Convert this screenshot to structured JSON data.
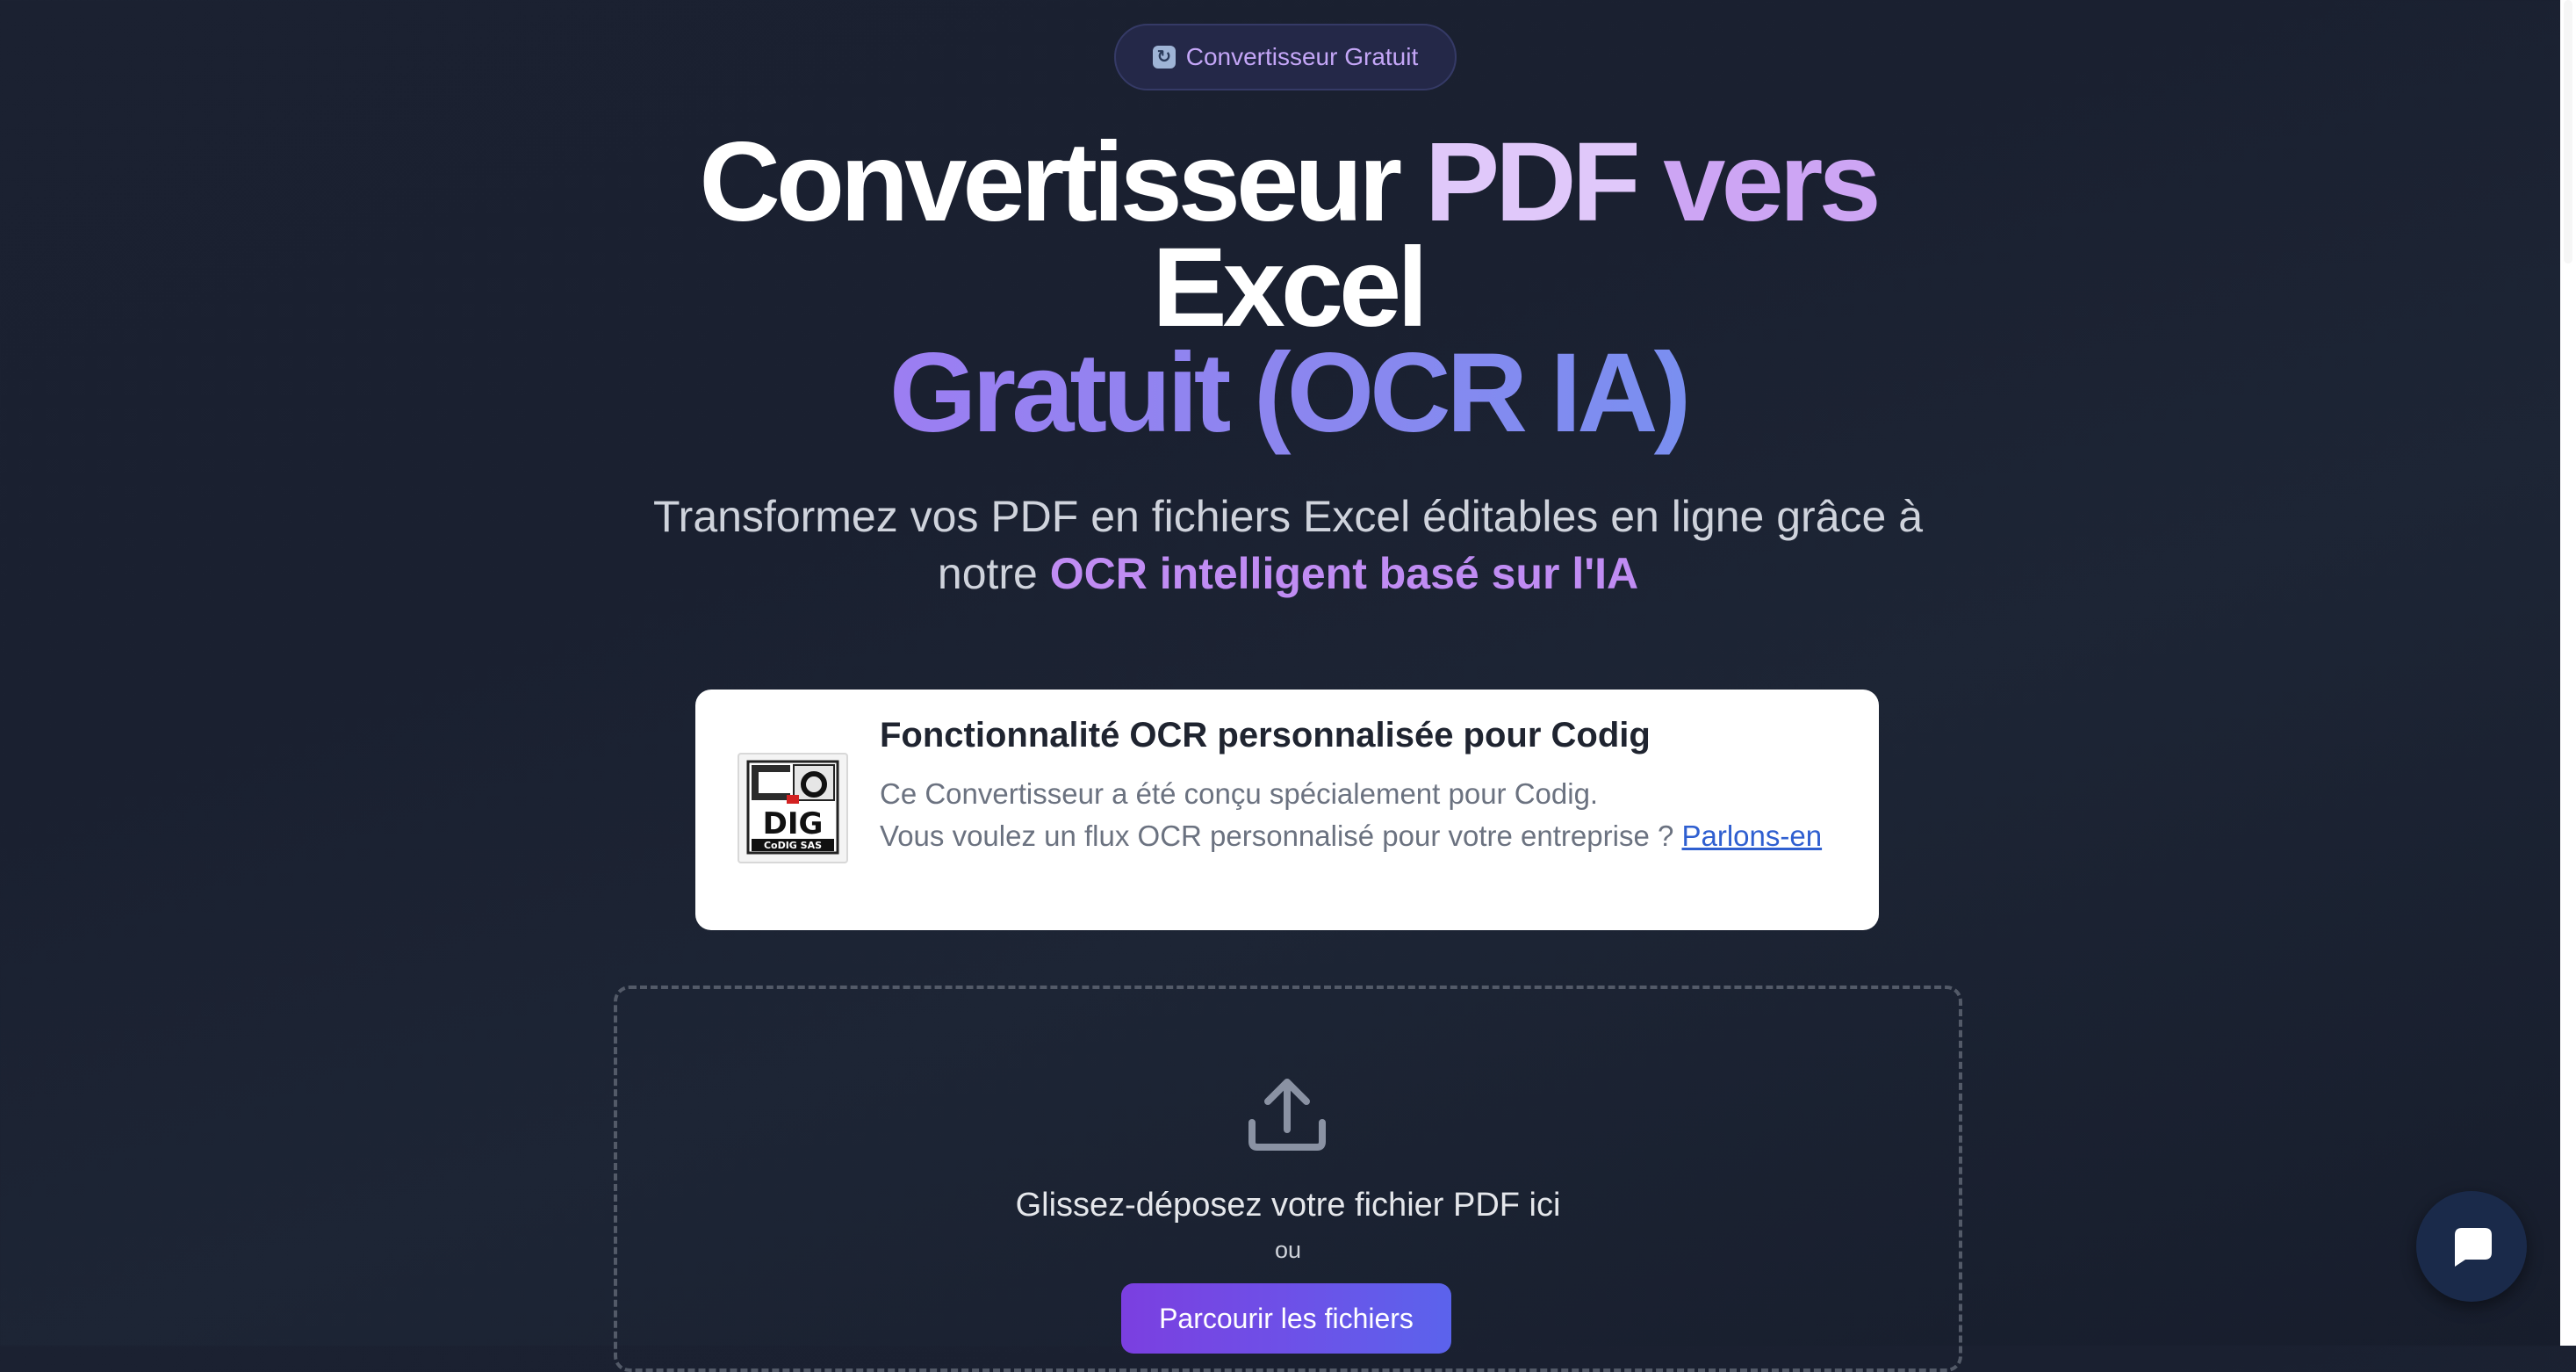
{
  "badge": {
    "icon": "refresh-icon",
    "label": "Convertisseur Gratuit",
    "color": "#c4a6f7"
  },
  "hero": {
    "title_part1": "Convertisseur",
    "title_part2": "PDF",
    "title_part3": "vers",
    "title_part4": "Excel",
    "title_part5": "Gratuit (OCR IA)",
    "subtitle_plain_1": "Transformez vos PDF en fichiers Excel éditables en ligne grâce à",
    "subtitle_plain_2": "notre",
    "subtitle_highlight": "OCR intelligent basé sur l'IA"
  },
  "info_card": {
    "logo_alt": "CoDIG SAS logo",
    "logo_text": "CoDIG SAS",
    "title": "Fonctionnalité OCR personnalisée pour Codig",
    "text_line1": "Ce Convertisseur a été conçu spécialement pour Codig.",
    "text_line2": "Vous voulez un flux OCR personnalisé pour votre entreprise ?",
    "link_label": "Parlons-en"
  },
  "dropzone": {
    "icon": "upload-icon",
    "drop_text": "Glissez-déposez votre fichier PDF ici",
    "or_text": "ou",
    "browse_label": "Parcourir les fichiers"
  },
  "chat": {
    "icon": "chat-bubble-icon"
  },
  "colors": {
    "accent_purple": "#c08cf3",
    "button_gradient_start": "#7b3fe0",
    "button_gradient_end": "#5b63ec",
    "link": "#2f5fd0"
  }
}
